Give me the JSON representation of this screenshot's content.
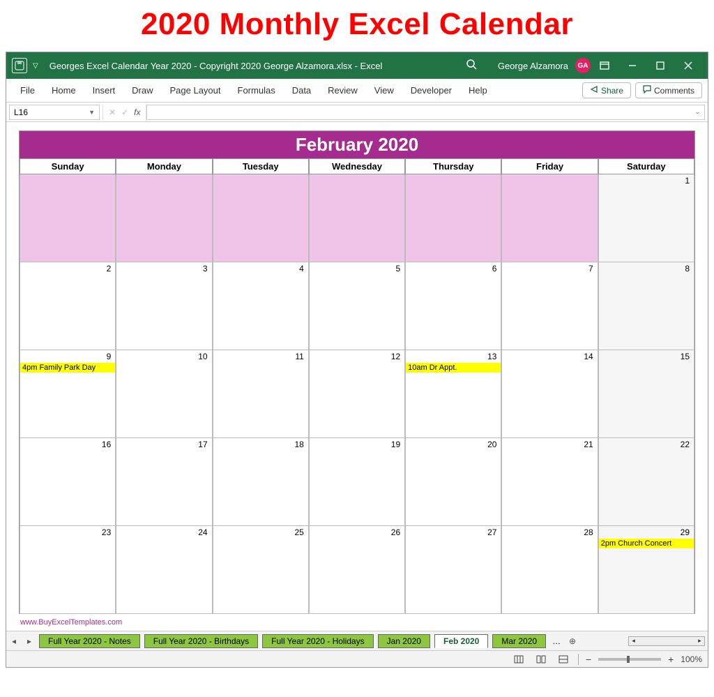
{
  "page_heading": "2020 Monthly Excel Calendar",
  "titlebar": {
    "document_title": "Georges Excel Calendar Year 2020 - Copyright 2020  George Alzamora.xlsx  -  Excel",
    "user_name": "George Alzamora",
    "user_initials": "GA"
  },
  "ribbon": {
    "tabs": [
      "File",
      "Home",
      "Insert",
      "Draw",
      "Page Layout",
      "Formulas",
      "Data",
      "Review",
      "View",
      "Developer",
      "Help"
    ],
    "share_label": "Share",
    "comments_label": "Comments"
  },
  "formulabar": {
    "cell_ref": "L16",
    "fx_label": "fx"
  },
  "calendar": {
    "title": "February 2020",
    "day_headers": [
      "Sunday",
      "Monday",
      "Tuesday",
      "Wednesday",
      "Thursday",
      "Friday",
      "Saturday"
    ],
    "weeks": [
      [
        {
          "pad": true
        },
        {
          "pad": true
        },
        {
          "pad": true
        },
        {
          "pad": true
        },
        {
          "pad": true
        },
        {
          "pad": true
        },
        {
          "num": "1",
          "weekend": true
        }
      ],
      [
        {
          "num": "2"
        },
        {
          "num": "3"
        },
        {
          "num": "4"
        },
        {
          "num": "5"
        },
        {
          "num": "6"
        },
        {
          "num": "7"
        },
        {
          "num": "8",
          "weekend": true
        }
      ],
      [
        {
          "num": "9",
          "event": "4pm Family Park Day"
        },
        {
          "num": "10"
        },
        {
          "num": "11"
        },
        {
          "num": "12"
        },
        {
          "num": "13",
          "event": "10am Dr Appt."
        },
        {
          "num": "14"
        },
        {
          "num": "15",
          "weekend": true
        }
      ],
      [
        {
          "num": "16"
        },
        {
          "num": "17"
        },
        {
          "num": "18"
        },
        {
          "num": "19"
        },
        {
          "num": "20"
        },
        {
          "num": "21"
        },
        {
          "num": "22",
          "weekend": true
        }
      ],
      [
        {
          "num": "23"
        },
        {
          "num": "24"
        },
        {
          "num": "25"
        },
        {
          "num": "26"
        },
        {
          "num": "27"
        },
        {
          "num": "28"
        },
        {
          "num": "29",
          "weekend": true,
          "event": "2pm Church Concert"
        }
      ]
    ],
    "footer_link": "www.BuyExcelTemplates.com"
  },
  "sheet_tabs": {
    "tabs": [
      {
        "label": "Full Year 2020 - Notes"
      },
      {
        "label": "Full Year 2020 - Birthdays"
      },
      {
        "label": "Full Year 2020 - Holidays"
      },
      {
        "label": "Jan 2020"
      },
      {
        "label": "Feb 2020",
        "active": true
      },
      {
        "label": "Mar 2020"
      }
    ],
    "more": "…"
  },
  "statusbar": {
    "zoom_label": "100%"
  }
}
